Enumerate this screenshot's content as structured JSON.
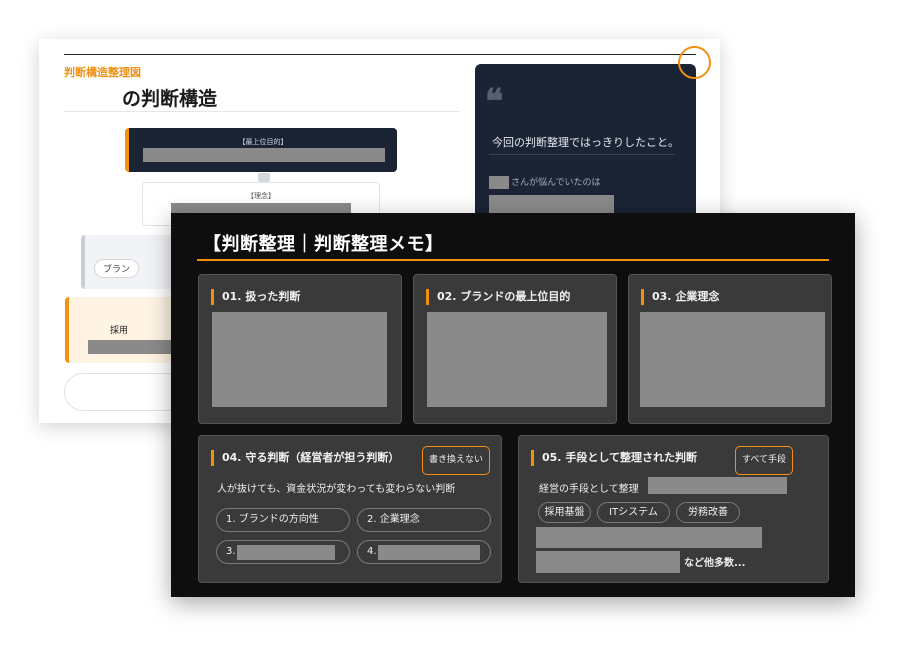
{
  "back_slide": {
    "kicker": "判断構造整理図",
    "title": "の判断構造",
    "top_box_label": "【最上位目的】",
    "rinen_label": "【理念】",
    "brand_pill": "ブラン",
    "saiyo_label": "採用",
    "quote_mark": "❝",
    "quote_heading": "今回の判断整理ではっきりしたこと。",
    "quote_sub": "さんが悩んでいたのは"
  },
  "memo": {
    "heading": "【判断整理｜判断整理メモ】",
    "cards": [
      {
        "title": "01. 扱った判断"
      },
      {
        "title": "02. ブランドの最上位目的"
      },
      {
        "title": "03. 企業理念"
      }
    ],
    "card4": {
      "title": "04. 守る判断（経営者が担う判断）",
      "button": "書き換えない",
      "desc": "人が抜けても、資金状況が変わっても変わらない判断",
      "items": [
        "1. ブランドの方向性",
        "2. 企業理念",
        "3.",
        "4."
      ]
    },
    "card5": {
      "title": "05. 手段として整理された判断",
      "button": "すべて手段",
      "desc": "経営の手段として整理",
      "tags": [
        "採用基盤",
        "ITシステム",
        "労務改善"
      ],
      "more": "など他多数..."
    }
  },
  "colors": {
    "accent": "#f29111",
    "navy": "#1b2435",
    "memo_bg": "#0e0e0e",
    "card_bg": "#3a3a3a",
    "redaction": "#8a8a8a"
  }
}
